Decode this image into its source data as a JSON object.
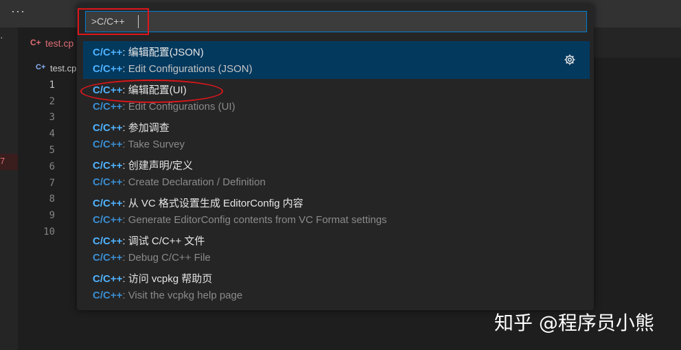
{
  "titlebar": {
    "more_icon": "more-horizontal-icon"
  },
  "tabs": [
    {
      "label": "test.cp",
      "icon": "cpp-file-icon"
    }
  ],
  "breadcrumb": {
    "label": "test.cp",
    "icon": "cpp-file-icon"
  },
  "gutter": {
    "marker": "7",
    "line_numbers": [
      "1",
      "2",
      "3",
      "4",
      "5",
      "6",
      "7",
      "8",
      "9",
      "10"
    ]
  },
  "quick_open": {
    "input_value": ">C/C++",
    "items": [
      {
        "category": "C/C++",
        "label": "编辑配置(JSON)",
        "detail_category": "C/C++",
        "detail": "Edit Configurations (JSON)",
        "selected": true,
        "action_icon": "gear-icon"
      },
      {
        "category": "C/C++",
        "label": "编辑配置(UI)",
        "detail_category": "C/C++",
        "detail": "Edit Configurations (UI)"
      },
      {
        "category": "C/C++",
        "label": "参加调查",
        "detail_category": "C/C++",
        "detail": "Take Survey"
      },
      {
        "category": "C/C++",
        "label": "创建声明/定义",
        "detail_category": "C/C++",
        "detail": "Create Declaration / Definition"
      },
      {
        "category": "C/C++",
        "label": "从 VC 格式设置生成 EditorConfig 内容",
        "detail_category": "C/C++",
        "detail": "Generate EditorConfig contents from VC Format settings"
      },
      {
        "category": "C/C++",
        "label": "调试 C/C++ 文件",
        "detail_category": "C/C++",
        "detail": "Debug C/C++ File"
      },
      {
        "category": "C/C++",
        "label": "访问 vcpkg 帮助页",
        "detail_category": "C/C++",
        "detail": "Visit the vcpkg help page"
      }
    ]
  },
  "watermark": "知乎 @程序员小熊",
  "colors": {
    "accent": "#007fd4",
    "selection": "#04395e",
    "annotation": "#e0161b",
    "category": "#4fb3ff"
  }
}
